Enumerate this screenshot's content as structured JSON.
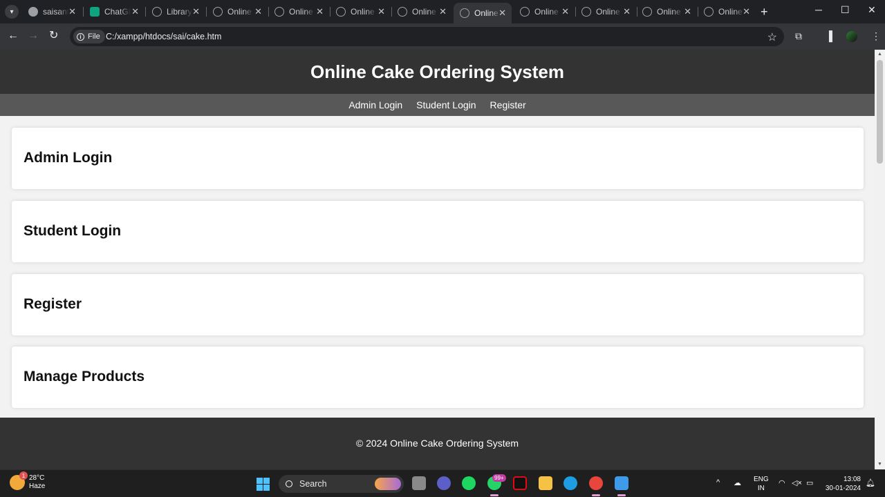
{
  "browser": {
    "tabs": [
      {
        "title": "saisant",
        "icon": "github-icon"
      },
      {
        "title": "ChatGPT",
        "icon": "chatgpt-icon"
      },
      {
        "title": "Library",
        "icon": "globe-icon"
      },
      {
        "title": "Online",
        "icon": "globe-icon"
      },
      {
        "title": "Online",
        "icon": "globe-icon"
      },
      {
        "title": "Online",
        "icon": "globe-icon"
      },
      {
        "title": "Online",
        "icon": "globe-icon"
      },
      {
        "title": "Online",
        "icon": "globe-icon",
        "active": true
      },
      {
        "title": "Online",
        "icon": "globe-icon"
      },
      {
        "title": "Online",
        "icon": "globe-icon"
      },
      {
        "title": "Online",
        "icon": "globe-icon"
      },
      {
        "title": "Online",
        "icon": "globe-icon"
      }
    ],
    "file_chip": "File",
    "url": "C:/xampp/htdocs/sai/cake.htm"
  },
  "site": {
    "title": "Online Cake Ordering System",
    "nav": [
      "Admin Login",
      "Student Login",
      "Register"
    ],
    "sections": [
      "Admin Login",
      "Student Login",
      "Register",
      "Manage Products"
    ],
    "footer": "© 2024 Online Cake Ordering System",
    "colors": {
      "header_bg": "#333333",
      "nav_bg": "#585858",
      "page_bg": "#f2f2f2",
      "card_bg": "#ffffff"
    }
  },
  "taskbar": {
    "weather_temp": "28°C",
    "weather_desc": "Haze",
    "weather_badge": "1",
    "search_label": "Search",
    "whatsapp_badge": "99+",
    "lang_top": "ENG",
    "lang_bottom": "IN",
    "time": "13:08",
    "date": "30-01-2024"
  }
}
